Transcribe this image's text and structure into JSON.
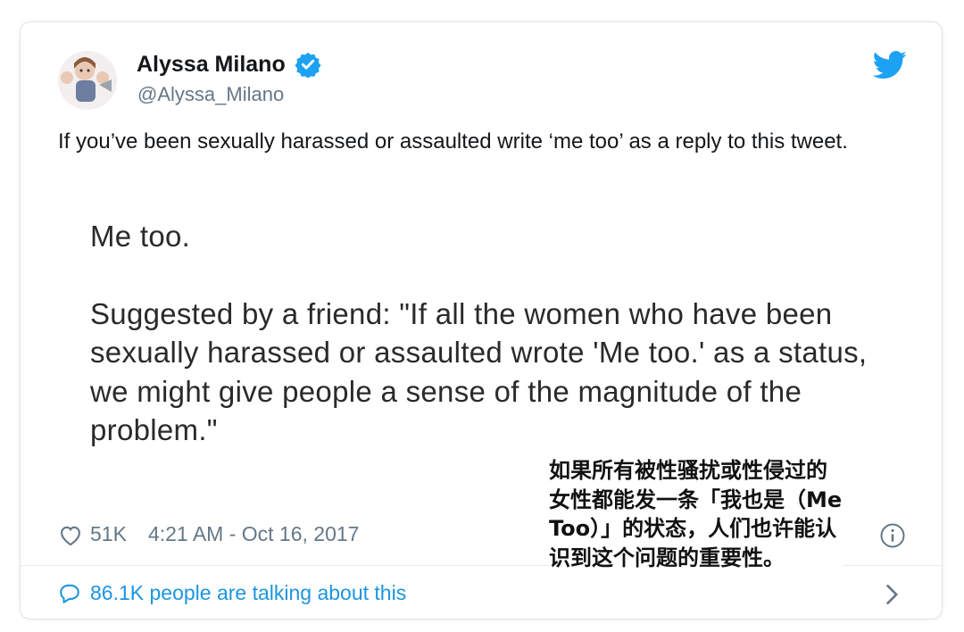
{
  "tweet": {
    "author_name": "Alyssa Milano",
    "author_handle": "@Alyssa_Milano",
    "text": "If you’ve been sexually harassed or assaulted write ‘me too’ as a reply to this tweet.",
    "embedded_lines": [
      "Me too.",
      "Suggested by a friend: \"If all the women who have been sexually harassed or assaulted wrote 'Me too.' as a status, we might give people a sense of the magnitude of the problem.\""
    ],
    "likes": "51K",
    "timestamp": "4:21 AM - Oct 16, 2017",
    "talking_about": "86.1K people are talking about this"
  },
  "caption": "如果所有被性骚扰或性侵过的女性都能发一条「我也是（Me Too）」的状态，人们也许能认识到这个问题的重要性。",
  "colors": {
    "twitter_blue": "#1da1f2",
    "link_blue": "#1b95e0",
    "muted_gray": "#657786",
    "text_dark": "#14171a"
  },
  "icons": [
    "verified-badge-icon",
    "twitter-bird-icon",
    "heart-icon",
    "info-icon",
    "comment-bubble-icon",
    "chevron-right-icon"
  ]
}
